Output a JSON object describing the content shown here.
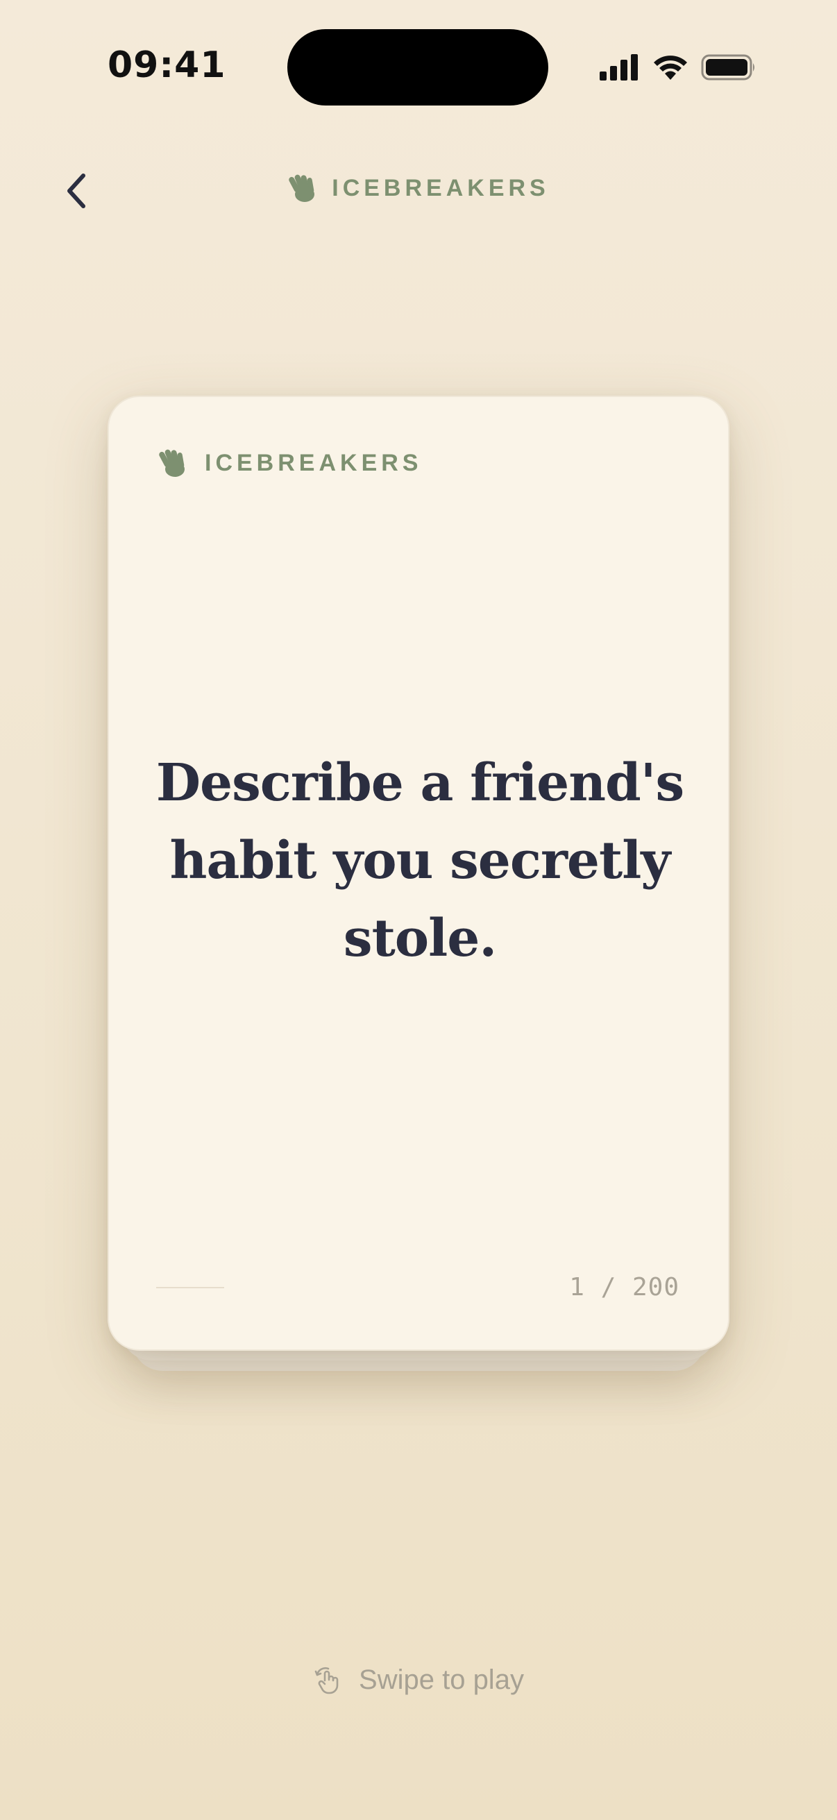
{
  "status_bar": {
    "time": "09:41"
  },
  "nav": {
    "back_icon": "chevron-left-icon",
    "title": "ICEBREAKERS",
    "logo_icon": "waving-hand-icon"
  },
  "card": {
    "brand": "ICEBREAKERS",
    "logo_icon": "waving-hand-icon",
    "question": "Describe a friend's habit you secretly stole.",
    "counter": "1 / 200"
  },
  "hint": {
    "icon": "swipe-hand-icon",
    "text": "Swipe to play"
  },
  "colors": {
    "accent": "#7d9070",
    "question_text": "#2b2e40",
    "card_bg": "#faf4e8",
    "page_bg": "#f2e8d4"
  }
}
